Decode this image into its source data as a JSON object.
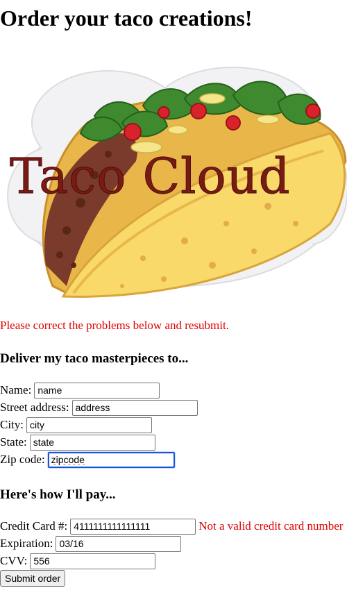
{
  "page": {
    "heading": "Order your taco creations!",
    "logo_text": "Taco Cloud",
    "validation_message": "Please correct the problems below and resubmit."
  },
  "delivery": {
    "heading": "Deliver my taco masterpieces to...",
    "name_label": "Name:",
    "name_value": "name",
    "street_label": "Street address:",
    "street_value": "address",
    "city_label": "City:",
    "city_value": "city",
    "state_label": "State:",
    "state_value": "state",
    "zip_label": "Zip code:",
    "zip_value": "zipcode"
  },
  "payment": {
    "heading": "Here's how I'll pay...",
    "cc_label": "Credit Card #:",
    "cc_value": "4111111111111111",
    "cc_error": "Not a valid credit card number",
    "exp_label": "Expiration:",
    "exp_value": "03/16",
    "cvv_label": "CVV:",
    "cvv_value": "556"
  },
  "actions": {
    "submit_label": "Submit order"
  },
  "colors": {
    "error": "#e00000",
    "focus": "#1a55d6",
    "logo_text": "#7a1a14"
  }
}
